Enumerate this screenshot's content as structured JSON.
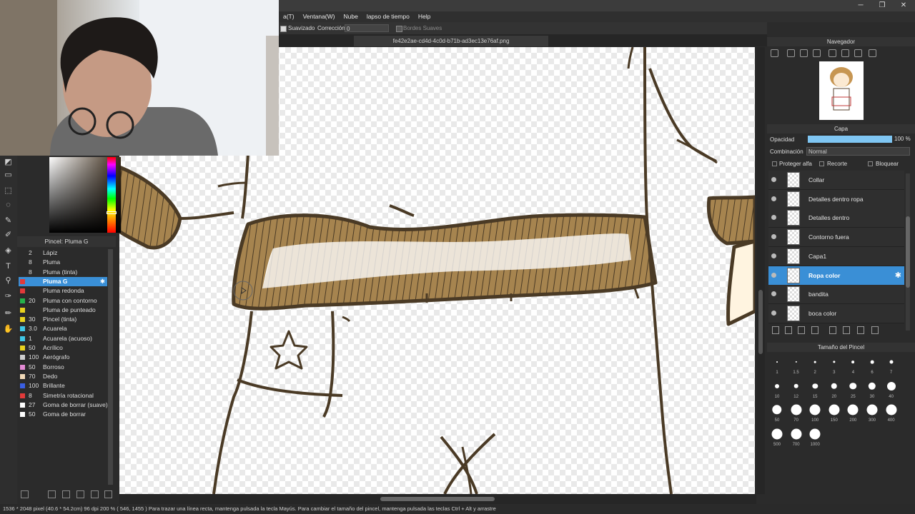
{
  "menu": [
    "a(T)",
    "Ventana(W)",
    "Nube",
    "lapso de tiempo",
    "Help"
  ],
  "toolbar": {
    "suavizado": "Suavizado",
    "correccion": "Corrección",
    "correccion_value": "0",
    "bordes": "Bordes Suaves"
  },
  "file_tab": "fe42e2ae-cd4d-4c0d-b71b-ad3ec13e76af.png",
  "brush_panel": {
    "title": "Pincel: Pluma G",
    "items": [
      {
        "size": "2",
        "name": "Lápiz",
        "color": "#2b2b2b"
      },
      {
        "size": "8",
        "name": "Pluma",
        "color": "#2b2b2b"
      },
      {
        "size": "8",
        "name": "Pluma (tinta)",
        "color": "#2b2b2b"
      },
      {
        "size": "",
        "name": "Pluma G",
        "color": "#e23a3a",
        "selected": true
      },
      {
        "size": "",
        "name": "Pluma redonda",
        "color": "#e23a3a"
      },
      {
        "size": "20",
        "name": "Pluma con contorno",
        "color": "#27b34a"
      },
      {
        "size": "",
        "name": "Pluma de punteado",
        "color": "#e8d21f"
      },
      {
        "size": "30",
        "name": "Pincel (tinta)",
        "color": "#e8d21f"
      },
      {
        "size": "3.0",
        "name": "Acuarela",
        "color": "#3fc7e6"
      },
      {
        "size": "1",
        "name": "Acuarela (acuoso)",
        "color": "#3fc7e6"
      },
      {
        "size": "50",
        "name": "Acrílico",
        "color": "#e8d21f"
      },
      {
        "size": "100",
        "name": "Aerógrafo",
        "color": "#cfcfcf"
      },
      {
        "size": "50",
        "name": "Borroso",
        "color": "#e58bd6"
      },
      {
        "size": "70",
        "name": "Dedo",
        "color": "#f1d9b8"
      },
      {
        "size": "100",
        "name": "Brillante",
        "color": "#3a5fe3"
      },
      {
        "size": "8",
        "name": "Simetría rotacional",
        "color": "#e23a3a"
      },
      {
        "size": "27",
        "name": "Goma de borrar (suave)",
        "color": "#ffffff"
      },
      {
        "size": "50",
        "name": "Goma de borrar",
        "color": "#ffffff"
      }
    ]
  },
  "navigator": {
    "title": "Navegador"
  },
  "layer_panel": {
    "title": "Capa",
    "opacity_label": "Opacidad",
    "opacity_value": "100 %",
    "opacity": 1.0,
    "blend_label": "Combinación",
    "blend_value": "Normal",
    "protect_alpha": "Proteger alfa",
    "clip": "Recorte",
    "lock": "Bloquear",
    "layers": [
      {
        "name": "Collar"
      },
      {
        "name": "Detalles dentro ropa"
      },
      {
        "name": "Detalles dentro"
      },
      {
        "name": "Contorno fuera"
      },
      {
        "name": "Capa1"
      },
      {
        "name": "Ropa color",
        "selected": true
      },
      {
        "name": "bandita"
      },
      {
        "name": "boca color"
      }
    ]
  },
  "brush_size_panel": {
    "title": "Tamaño del Pincel",
    "sizes": [
      "1",
      "1.5",
      "2",
      "3",
      "4",
      "6",
      "7",
      "10",
      "12",
      "15",
      "20",
      "25",
      "30",
      "40",
      "50",
      "70",
      "100",
      "150",
      "200",
      "300",
      "400",
      "500",
      "700",
      "1000"
    ]
  },
  "status": "1536 * 2048 pixel   (40.6 * 54.2cm)   96 dpi   200 %   ( 546, 1455 )   Para trazar una línea recta, mantenga pulsada la tecla Mayús. Para cambiar el tamaño del pincel, mantenga pulsada las teclas Ctrl + Alt y arrastre",
  "colors": {
    "accent": "#3a8fd6",
    "outline": "#4a3a25",
    "fill": "#a6844f"
  }
}
